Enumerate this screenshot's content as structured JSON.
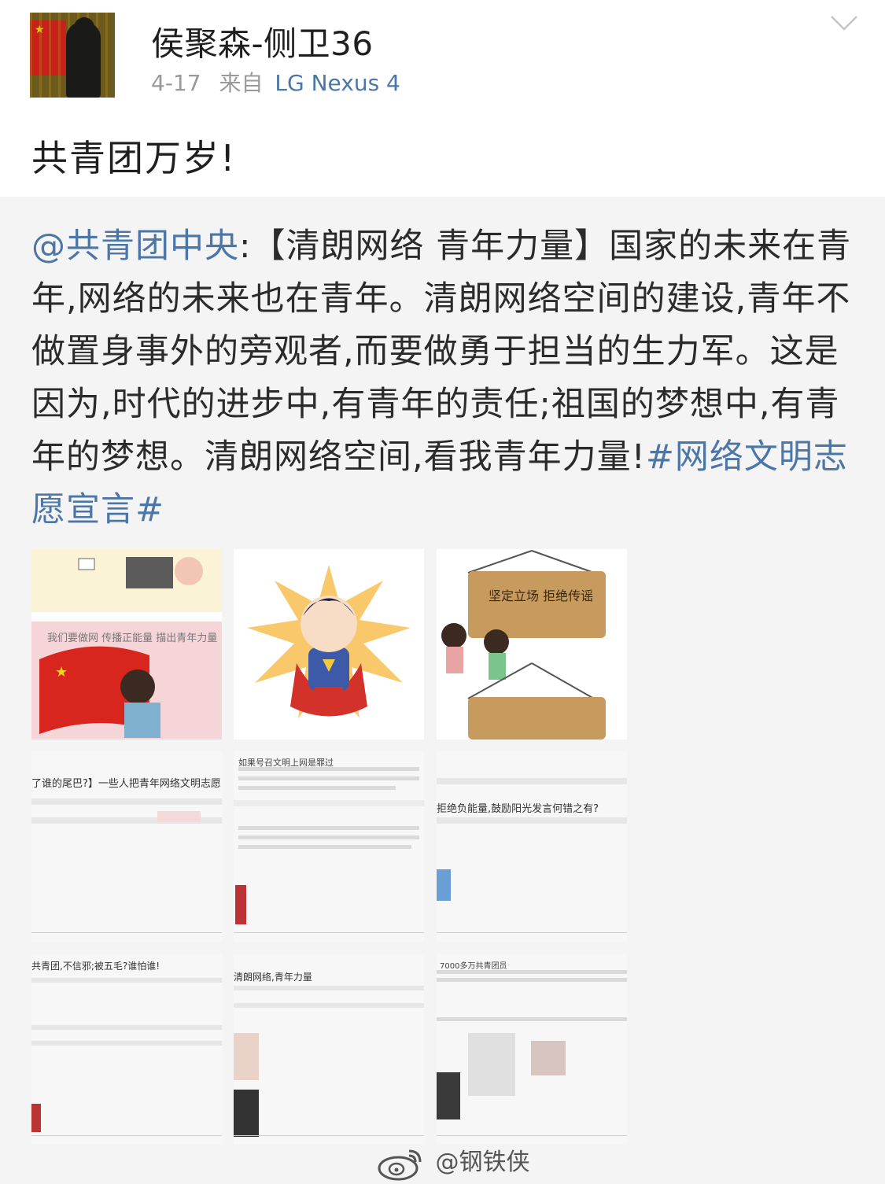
{
  "post": {
    "author": "侯聚森-侧卫36",
    "date": "4-17",
    "from_label": "来自",
    "device": "LG Nexus 4",
    "text": "共青团万岁!"
  },
  "repost": {
    "mention": "@共青团中央",
    "colon": ":",
    "text": "【清朗网络 青年力量】国家的未来在青年,网络的未来也在青年。清朗网络空间的建设,青年不做置身事外的旁观者,而要做勇于担当的生力军。这是因为,时代的进步中,有青年的责任;祖国的梦想中,有青年的梦想。清朗网络空间,看我青年力量!",
    "hashtag": "#网络文明志愿宣言#"
  },
  "images": [
    {
      "name": "cartoon-flag-girls-image",
      "label": "我们要做网 传播正能量 描出青年力量"
    },
    {
      "name": "cartoon-superman-image",
      "label": ""
    },
    {
      "name": "cartoon-signboard-image",
      "label": "坚定立场 拒绝传谣"
    },
    {
      "name": "screenshot-weibo-1-image",
      "label": "了谁的尾巴?】一些人把青年网络文明志愿"
    },
    {
      "name": "screenshot-weibo-2-image",
      "label": "如果号召文明上网是罪过"
    },
    {
      "name": "screenshot-weibo-3-image",
      "label": "拒绝负能量,鼓励阳光发言何错之有?"
    },
    {
      "name": "screenshot-weibo-4-image",
      "label": "共青团,不信邪;被五毛?谁怕谁!"
    },
    {
      "name": "screenshot-weibo-5-image",
      "label": "清朗网络,青年力量"
    },
    {
      "name": "screenshot-weibo-6-image",
      "label": "7000多万共青团员"
    }
  ],
  "watermark": "@钢铁侠",
  "icons": {
    "chevron": "chevron-down-icon",
    "weibo": "weibo-logo-icon"
  },
  "colors": {
    "link": "#4d76a8",
    "background": "#f4f4f4"
  }
}
